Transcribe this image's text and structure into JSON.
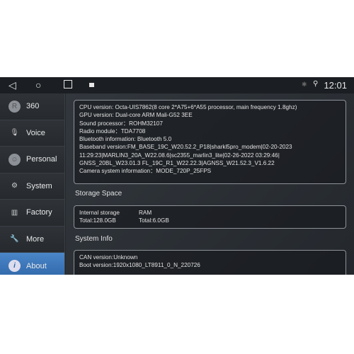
{
  "statusbar": {
    "time": "12:01",
    "icons": [
      "back-icon",
      "home-icon",
      "recents-icon",
      "screenshot-icon",
      "bluetooth-icon",
      "location-icon"
    ]
  },
  "sidebar": {
    "items": [
      {
        "label": "360",
        "icon": "360-icon"
      },
      {
        "label": "Voice",
        "icon": "microphone-icon"
      },
      {
        "label": "Personal",
        "icon": "person-icon"
      },
      {
        "label": "System",
        "icon": "gears-icon"
      },
      {
        "label": "Factory",
        "icon": "factory-icon"
      },
      {
        "label": "More",
        "icon": "wrench-icon"
      },
      {
        "label": "About",
        "icon": "info-icon",
        "active": true
      }
    ]
  },
  "device_info": [
    "CPU version: Octa-UIS7862(8 core 2*A75+6*A55 processor, main frequency 1.8ghz)",
    "GPU version: Dual-core ARM Mali-G52 3EE",
    "Sound processor：ROHM32107",
    "Radio module：TDA7708",
    "Bluetooth information: Bluetooth 5.0",
    "Baseband version:FM_BASE_19C_W20.52.2_P18|sharkl5pro_modem|02-20-2023",
    "11:29:23|MARLIN3_20A_W22.08.6|sc2355_marlin3_lite|02-26-2022 03:29:46|",
    "GNSS_20BL_W23.01.3 FL_19C_R1_W22.22.3|AGNSS_W21.52.3_V1.6.22",
    "Camera system information：MODE_720P_25FPS"
  ],
  "storage": {
    "title": "Storage Space",
    "internal_label": "Internal storage",
    "internal_total": "Total:128.0GB",
    "ram_label": "RAM",
    "ram_total": "Total:6.0GB"
  },
  "system_info": {
    "title": "System Info",
    "lines": [
      "CAN version:Unknown",
      "Boot version:1920x1080_LT8911_0_N_220726"
    ]
  }
}
